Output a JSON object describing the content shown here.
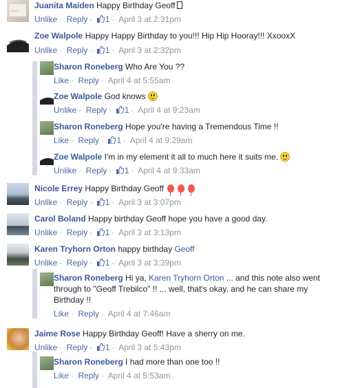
{
  "actions": {
    "unlike": "Unlike",
    "like": "Like",
    "reply": "Reply",
    "separator": "·"
  },
  "comments": [
    {
      "name": "Juanita Maiden",
      "text": "Happy Birthday Geoff",
      "likes": "1",
      "time": "April 3 at 2:31pm"
    },
    {
      "name": "Zoe Walpole",
      "text": "Happy Happy Birthday to you!!! Hip Hip Hooray!!! XxooxX",
      "likes": "1",
      "time": "April 3 at 2:32pm"
    },
    {
      "name": "Sharon Roneberg",
      "text": "Who Are You ??",
      "time": "April 4 at 5:55am"
    },
    {
      "name": "Zoe Walpole",
      "text": "God knows",
      "likes": "1",
      "time": "April 4 at 9:23am"
    },
    {
      "name": "Sharon Roneberg",
      "text": "Hope you're having a Tremendous Time !!",
      "likes": "1",
      "time": "April 4 at 9:29am"
    },
    {
      "name": "Zoe Walpole",
      "text": "I'm in my element it all to much here it suits me.",
      "likes": "1",
      "time": "April 4 at 9:33am"
    },
    {
      "name": "Nicole Errey",
      "text": "Happy Birthday Geoff",
      "likes": "1",
      "time": "April 3 at 3:07pm"
    },
    {
      "name": "Carol Boland",
      "text": "Happy birthday Geoff hope you have a good day.",
      "likes": "1",
      "time": "April 3 at 3:13pm"
    },
    {
      "name": "Karen Tryhorn Orton",
      "text": "happy birthday",
      "mention": "Geoff",
      "likes": "1",
      "time": "April 3 at 3:39pm"
    },
    {
      "name": "Sharon Roneberg",
      "text_a": "Hi ya,",
      "mention": "Karen Tryhorn Orton",
      "text_b": "... and this note also went",
      "text_c": "through to \"Geoff Trebilco\" !! ... well, that's okay, and he can share my",
      "text_d": "Birthday !!",
      "time": "April 4 at 7:46am"
    },
    {
      "name": "Jaime Rose",
      "text": "Happy Birthday Geoff! Have a sherry on me.",
      "likes": "1",
      "time": "April 3 at 5:43pm"
    },
    {
      "name": "Sharon Roneberg",
      "text": "I had more than one too !!",
      "time": "April 4 at 5:53am"
    }
  ]
}
